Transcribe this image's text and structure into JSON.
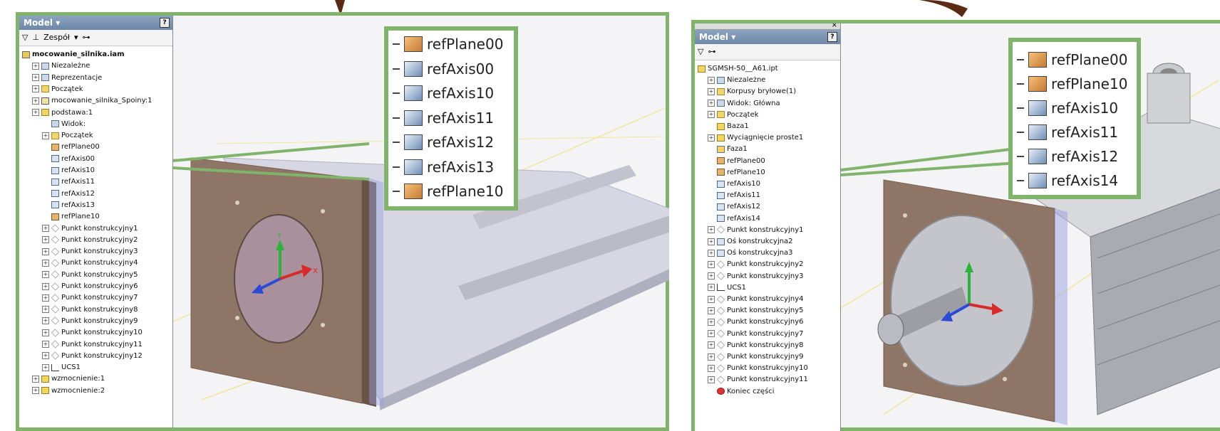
{
  "left": {
    "panel_title": "Model ▾",
    "toolbar": {
      "filter_icon": "funnel-icon",
      "assembly_label": "Zespół",
      "dropdown_icon": "chevron-down-icon",
      "find_icon": "binoculars-icon"
    },
    "tree": [
      {
        "label": "mocowanie_silnika.iam",
        "icon": "asm",
        "bold": true
      },
      {
        "label": "Niezależne",
        "icon": "rep"
      },
      {
        "label": "Reprezentacje",
        "icon": "rep"
      },
      {
        "label": "Początek",
        "icon": "folder"
      },
      {
        "label": "mocowanie_silnika_Spoiny:1",
        "icon": "weld"
      },
      {
        "label": "podstawa:1",
        "icon": "part"
      },
      {
        "label": "Widok:",
        "icon": "rep"
      },
      {
        "label": "Początek",
        "icon": "folder"
      },
      {
        "label": "refPlane00",
        "icon": "plane"
      },
      {
        "label": "refAxis00",
        "icon": "axis"
      },
      {
        "label": "refAxis10",
        "icon": "axis"
      },
      {
        "label": "refAxis11",
        "icon": "axis"
      },
      {
        "label": "refAxis12",
        "icon": "axis"
      },
      {
        "label": "refAxis13",
        "icon": "axis"
      },
      {
        "label": "refPlane10",
        "icon": "plane"
      },
      {
        "label": "Punkt konstrukcyjny1",
        "icon": "point"
      },
      {
        "label": "Punkt konstrukcyjny2",
        "icon": "point"
      },
      {
        "label": "Punkt konstrukcyjny3",
        "icon": "point"
      },
      {
        "label": "Punkt konstrukcyjny4",
        "icon": "point"
      },
      {
        "label": "Punkt konstrukcyjny5",
        "icon": "point"
      },
      {
        "label": "Punkt konstrukcyjny6",
        "icon": "point"
      },
      {
        "label": "Punkt konstrukcyjny7",
        "icon": "point"
      },
      {
        "label": "Punkt konstrukcyjny8",
        "icon": "point"
      },
      {
        "label": "Punkt konstrukcyjny9",
        "icon": "point"
      },
      {
        "label": "Punkt konstrukcyjny10",
        "icon": "point"
      },
      {
        "label": "Punkt konstrukcyjny11",
        "icon": "point"
      },
      {
        "label": "Punkt konstrukcyjny12",
        "icon": "point"
      },
      {
        "label": "UCS1",
        "icon": "ucs"
      },
      {
        "label": "wzmocnienie:1",
        "icon": "part"
      },
      {
        "label": "wzmocnienie:2",
        "icon": "part"
      }
    ],
    "callout": [
      "refPlane00",
      "refAxis00",
      "refAxis10",
      "refAxis11",
      "refAxis12",
      "refAxis13",
      "refPlane10"
    ],
    "callout_icons": [
      "plane",
      "axis",
      "axis",
      "axis",
      "axis",
      "axis",
      "plane"
    ]
  },
  "right": {
    "panel_title": "Model ▾",
    "toolbar": {
      "filter_icon": "funnel-icon",
      "find_icon": "binoculars-icon"
    },
    "tree": [
      {
        "label": "SGMSH-50__A61.ipt",
        "icon": "part"
      },
      {
        "label": "Niezależne",
        "icon": "rep"
      },
      {
        "label": "Korpusy bryłowe(1)",
        "icon": "folder"
      },
      {
        "label": "Widok: Główna",
        "icon": "rep"
      },
      {
        "label": "Początek",
        "icon": "folder"
      },
      {
        "label": "Baza1",
        "icon": "part"
      },
      {
        "label": "Wyciągnięcie proste1",
        "icon": "part"
      },
      {
        "label": "Faza1",
        "icon": "face"
      },
      {
        "label": "refPlane00",
        "icon": "plane"
      },
      {
        "label": "refPlane10",
        "icon": "plane"
      },
      {
        "label": "refAxis10",
        "icon": "axis"
      },
      {
        "label": "refAxis11",
        "icon": "axis"
      },
      {
        "label": "refAxis12",
        "icon": "axis"
      },
      {
        "label": "refAxis14",
        "icon": "axis"
      },
      {
        "label": "Punkt konstrukcyjny1",
        "icon": "point"
      },
      {
        "label": "Oś konstrukcyjna2",
        "icon": "axis"
      },
      {
        "label": "Oś konstrukcyjna3",
        "icon": "axis"
      },
      {
        "label": "Punkt konstrukcyjny2",
        "icon": "point"
      },
      {
        "label": "Punkt konstrukcyjny3",
        "icon": "point"
      },
      {
        "label": "UCS1",
        "icon": "ucs"
      },
      {
        "label": "Punkt konstrukcyjny4",
        "icon": "point"
      },
      {
        "label": "Punkt konstrukcyjny5",
        "icon": "point"
      },
      {
        "label": "Punkt konstrukcyjny6",
        "icon": "point"
      },
      {
        "label": "Punkt konstrukcyjny7",
        "icon": "point"
      },
      {
        "label": "Punkt konstrukcyjny8",
        "icon": "point"
      },
      {
        "label": "Punkt konstrukcyjny9",
        "icon": "point"
      },
      {
        "label": "Punkt konstrukcyjny10",
        "icon": "point"
      },
      {
        "label": "Punkt konstrukcyjny11",
        "icon": "point"
      },
      {
        "label": "Koniec części",
        "icon": "end"
      }
    ],
    "callout": [
      "refPlane00",
      "refPlane10",
      "refAxis10",
      "refAxis11",
      "refAxis12",
      "refAxis14"
    ],
    "callout_icons": [
      "plane",
      "plane",
      "axis",
      "axis",
      "axis",
      "axis"
    ]
  },
  "colors": {
    "frame_green": "#7fb46a",
    "arrow_brown": "#5a2a14",
    "plate_brown": "#8a6e5c"
  }
}
